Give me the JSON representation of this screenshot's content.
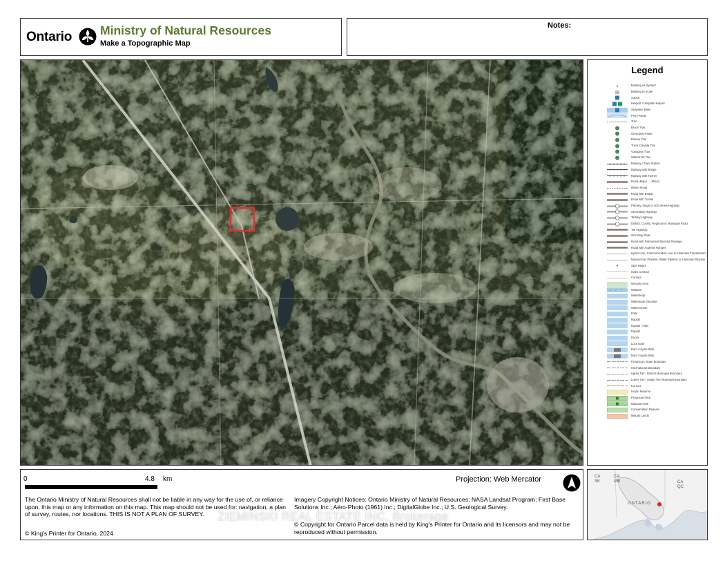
{
  "header": {
    "logo_word": "Ontario",
    "ministry": "Ministry of Natural Resources",
    "subtitle": "Make a Topographic Map"
  },
  "notes": {
    "label": "Notes:"
  },
  "legend": {
    "title": "Legend",
    "items": [
      {
        "label": "Building as Symbol",
        "icon": "dot"
      },
      {
        "label": "Building to Scale",
        "icon": "building"
      },
      {
        "label": "Airport",
        "icon": "airport"
      },
      {
        "label": "Heliport / Hospital Heliport",
        "icon": "heliport"
      },
      {
        "label": "Seaplane Base",
        "icon": "seaplane"
      },
      {
        "label": "Ferry Route",
        "icon": "ferry"
      },
      {
        "label": "Trail",
        "icon": "trail"
      },
      {
        "label": "Bruce Trail",
        "icon": "trail-marker"
      },
      {
        "label": "Greenbelt Route",
        "icon": "trail-marker"
      },
      {
        "label": "Rideau Trail",
        "icon": "trail-marker"
      },
      {
        "label": "Trans Canada Trail",
        "icon": "trail-marker"
      },
      {
        "label": "Voyageur Trail",
        "icon": "trail-marker"
      },
      {
        "label": "Waterfront Trail",
        "icon": "trail-marker"
      },
      {
        "label": "Railway / Train Station",
        "icon": "railway"
      },
      {
        "label": "Railway with Bridge",
        "icon": "railway"
      },
      {
        "label": "Railway with Tunnel",
        "icon": "railway"
      },
      {
        "label": "Road (Major → Minor)",
        "icon": "road"
      },
      {
        "label": "Winter Road",
        "icon": "road-dash"
      },
      {
        "label": "Road with Bridge",
        "icon": "road"
      },
      {
        "label": "Road with Tunnel",
        "icon": "road"
      },
      {
        "label": "Primary, Kings or 400 Series Highway",
        "icon": "highway"
      },
      {
        "label": "Secondary Highway",
        "icon": "highway"
      },
      {
        "label": "Tertiary Highway",
        "icon": "highway"
      },
      {
        "label": "District, County, Regional or Municipal Road",
        "icon": "highway"
      },
      {
        "label": "Toll Highway",
        "icon": "road"
      },
      {
        "label": "One Way Road",
        "icon": "road"
      },
      {
        "label": "Road with Permanent Blocked Passage",
        "icon": "road"
      },
      {
        "label": "Road with Address Ranges",
        "icon": "road"
      },
      {
        "label": "Hydro Line, Communication Line or Unknown Transmission Line",
        "icon": "line"
      },
      {
        "label": "Natural Gas Pipeline, Water Pipeline or Unknown Pipeline",
        "icon": "line"
      },
      {
        "label": "Spot Height",
        "icon": "dot"
      },
      {
        "label": "Index Contour",
        "icon": "contour"
      },
      {
        "label": "Contour",
        "icon": "contour"
      },
      {
        "label": "Wooded Area",
        "icon": "wooded"
      },
      {
        "label": "Wetland",
        "icon": "wetland"
      },
      {
        "label": "Waterbody",
        "icon": "water"
      },
      {
        "label": "Waterbody Elevation",
        "icon": "water"
      },
      {
        "label": "Watercourse",
        "icon": "water"
      },
      {
        "label": "Falls",
        "icon": "water"
      },
      {
        "label": "Rapids",
        "icon": "water"
      },
      {
        "label": "Rapids / Falls",
        "icon": "water"
      },
      {
        "label": "Rapids",
        "icon": "water"
      },
      {
        "label": "Rocks",
        "icon": "water"
      },
      {
        "label": "Lock Gate",
        "icon": "water"
      },
      {
        "label": "Dam / Hydro Wall",
        "icon": "dam"
      },
      {
        "label": "Dam / Hydro Wall",
        "icon": "dam"
      },
      {
        "label": "Provincial / State Boundary",
        "icon": "boundary"
      },
      {
        "label": "International Boundary",
        "icon": "boundary"
      },
      {
        "label": "Upper Tier / District Municipal Boundary",
        "icon": "boundary"
      },
      {
        "label": "Lower Tier / Single Tier Municipal Boundary",
        "icon": "boundary"
      },
      {
        "label": "Lot Line",
        "icon": "boundary"
      },
      {
        "label": "Indian Reserve",
        "icon": "reserve"
      },
      {
        "label": "Provincial Park",
        "icon": "park"
      },
      {
        "label": "National Park",
        "icon": "park"
      },
      {
        "label": "Conservation Reserve",
        "icon": "conservation"
      },
      {
        "label": "Military Lands",
        "icon": "military"
      }
    ]
  },
  "bottom": {
    "scale_start": "0",
    "scale_end": "4.8",
    "scale_unit": "km",
    "projection": "Projection: Web Mercator",
    "disclaimer": "The Ontario Ministry of Natural Resources shall not be liable in any way for the use of, or reliance upon, this map or any information on this map.  This map should not be used for: navigation, a plan of survey, routes, nor locations. THIS IS NOT A PLAN OF SURVEY.",
    "copyright": "© King's Printer for Ontario,  2024",
    "imagery": "Imagery Copyright Notices: Ontario Ministry of Natural Resources; NASA Landsat Program; First Base Solutions Inc.; Aéro-Photo (1961) Inc.; DigitalGlobe Inc.; U.S. Geological Survey.",
    "parcel": "© Copyright for Ontario Parcel data is held by King's Printer for Ontario and its licensors and may not be reproduced without permission.",
    "watermark": "ZIEMINSKI REAL ESTATE INC. Brokerage"
  },
  "inset": {
    "labels": [
      "CA",
      "SK",
      "CA",
      "MB",
      "CA",
      "QC",
      "ONTARIO"
    ]
  },
  "colors": {
    "ministry_green": "#5a7a2e",
    "highlight_box": "#e03030",
    "location_dot": "#e02020"
  }
}
